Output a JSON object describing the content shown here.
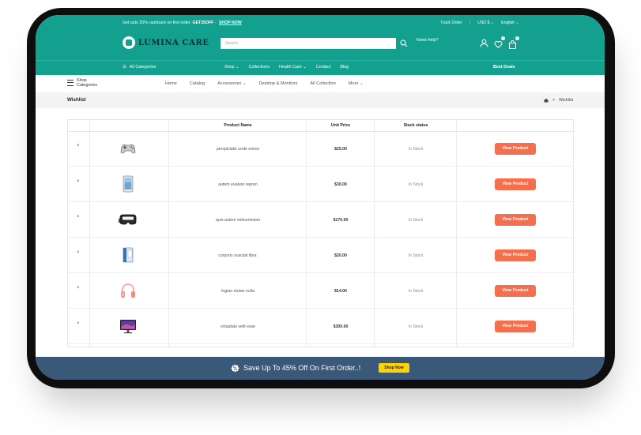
{
  "promo": {
    "prefix": "Get upto 25% cashback on first order:",
    "code": "GET25OFF",
    "dash": "-",
    "link": "SHOP NOW"
  },
  "top_links": {
    "track": "Track Order",
    "currency": "USD $",
    "language": "English"
  },
  "brand": {
    "name": "LUMINA CARE"
  },
  "search": {
    "placeholder": "Search"
  },
  "help": {
    "label": "Need Help?"
  },
  "header_icons": {
    "wishlist_count": "0",
    "cart_count": "0"
  },
  "nav": {
    "all_categories": "All Categories",
    "items": [
      "Shop",
      "Collections",
      "Health Care",
      "Contact",
      "Blog"
    ],
    "best_deals": "Best Deals"
  },
  "subnav": {
    "shop_categories_line1": "Shop",
    "shop_categories_line2": "Categories",
    "links": [
      "Home",
      "Catalog",
      "Accessories",
      "Desktop & Monitors",
      "All Collection",
      "More"
    ]
  },
  "breadcrumb": {
    "title": "Wishlist",
    "separator": ">",
    "current": "Wishlist"
  },
  "table": {
    "headers": {
      "name": "Product Name",
      "price": "Unit Price",
      "stock": "Stock status"
    },
    "remove_symbol": "×",
    "button_label": "View Product",
    "rows": [
      {
        "icon": "gamepad-icon",
        "name": "perspiciatis unde omnis",
        "price": "$25.00",
        "stock": "In Stock"
      },
      {
        "icon": "tablet-icon",
        "name": "autem eualure repren",
        "price": "$30.00",
        "stock": "In Stock"
      },
      {
        "icon": "vr-headset-icon",
        "name": "quis autem veleuminium",
        "price": "$170.00",
        "stock": "In Stock"
      },
      {
        "icon": "speaker-box-icon",
        "name": "corporis suscipit libor.",
        "price": "$20.00",
        "stock": "In Stock"
      },
      {
        "icon": "headphones-icon",
        "name": "fugian olutas nulla",
        "price": "$14.00",
        "stock": "In Stock"
      },
      {
        "icon": "monitor-icon",
        "name": "voluptate velit esse",
        "price": "$300.00",
        "stock": "In Stock"
      }
    ]
  },
  "footer": {
    "text": "Save Up To 45% Off On First Order..!",
    "button": "Shop Now"
  },
  "colors": {
    "teal": "#14a08f",
    "orange_button": "#f36f4e",
    "footer_bar": "#3a5878",
    "shop_now_yellow": "#ffd400"
  }
}
